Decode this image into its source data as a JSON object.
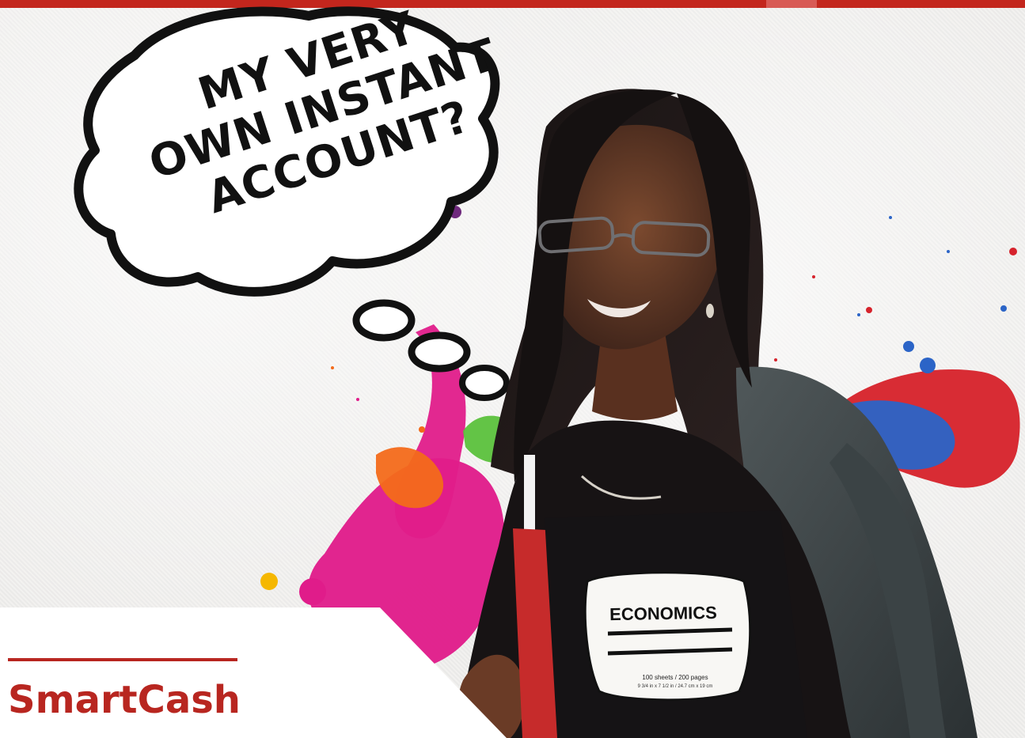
{
  "header": {
    "accent_color": "#c3261d",
    "highlight_tab_color": "#d85a55"
  },
  "hero": {
    "thought_bubble": {
      "line_1": "MY VERY",
      "line_2": "OWN INSTANT",
      "line_3": "ACCOUNT?"
    },
    "subject": "student-with-notebook-and-backpack",
    "notebook_label": "ECONOMICS",
    "notebook_subtext": "100 sheets / 200 pages",
    "notebook_small_print": "9 3/4 in x 7 1/2 in / 24.7 cm x 19 cm",
    "paint_colors": [
      "#e01c8a",
      "#f36a1a",
      "#2b64c7",
      "#d6232c",
      "#5bc13c"
    ]
  },
  "brand": {
    "name": "SmartCash",
    "color": "#b82620"
  }
}
